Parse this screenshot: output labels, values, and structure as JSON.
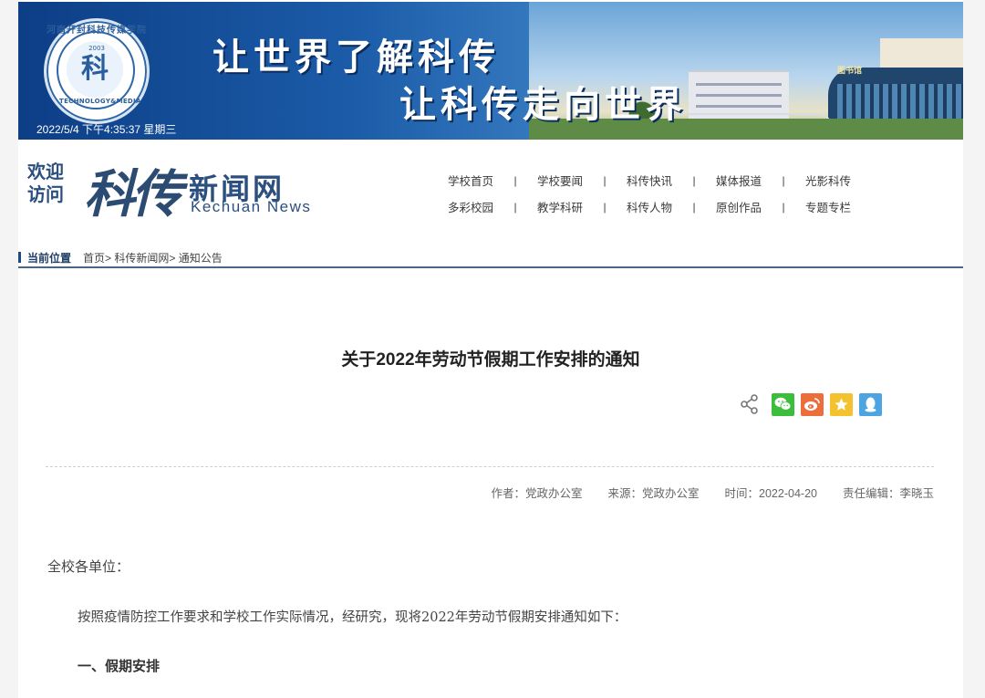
{
  "banner": {
    "logo": {
      "monogram": "科",
      "arc_text": "河南开封科技传媒学院",
      "year": "2003",
      "en_text": "TECHNOLOGY&MEDIA"
    },
    "slogan_line1": "让世界了解科传",
    "slogan_line2": "让科传走向世界",
    "building_sign": "图书馆",
    "datetime": "2022/5/4 下午4:35:37 星期三"
  },
  "header": {
    "welcome": "欢迎访问",
    "brush": "科传",
    "title": "新闻网",
    "subtitle": "Kechuan News"
  },
  "nav": {
    "row1": [
      "学校首页",
      "学校要闻",
      "科传快讯",
      "媒体报道",
      "光影科传"
    ],
    "row2": [
      "多彩校园",
      "教学科研",
      "科传人物",
      "原创作品",
      "专题专栏"
    ],
    "separator": "|"
  },
  "breadcrumb": {
    "label": "当前位置",
    "items": [
      "首页>",
      "科传新闻网>",
      "通知公告"
    ]
  },
  "article": {
    "title": "关于2022年劳动节假期工作安排的通知",
    "share": {
      "icons": [
        "share-icon",
        "wechat-icon",
        "weibo-icon",
        "favorite-star-icon",
        "qq-icon"
      ],
      "colors": {
        "wechat": "#3dbd3c",
        "weibo": "#ec6e3b",
        "favorite": "#f3c22e",
        "qq": "#4ca5e1"
      }
    },
    "meta": {
      "author": "作者：党政办公室",
      "source": "来源：党政办公室",
      "time": "时间：2022-04-20",
      "editor": "责任编辑：李晓玉"
    },
    "greeting": "全校各单位：",
    "paragraph1": "按照疫情防控工作要求和学校工作实际情况，经研究，现将2022年劳动节假期安排通知如下：",
    "section1": "一、假期安排"
  }
}
